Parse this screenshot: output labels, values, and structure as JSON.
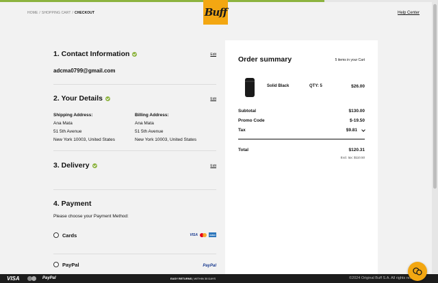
{
  "header": {
    "breadcrumb": [
      "HOME",
      "SHOPPING CART",
      "CHECKOUT"
    ],
    "logo_text": "Buff",
    "help_label": "Help Center",
    "progress_fraction": 0.74
  },
  "sections": {
    "contact": {
      "title": "1. Contact Information",
      "edit": "Edit",
      "email": "adcma0799@gmail.com"
    },
    "details": {
      "title": "2. Your Details",
      "edit": "Edit",
      "shipping": {
        "label": "Shipping Address:",
        "name": "Ana Mata",
        "street": "51 5th Avenue",
        "city": "New York 10003, United States"
      },
      "billing": {
        "label": "Billing Address:",
        "name": "Ana Mata",
        "street": "51 5th Avenue",
        "city": "New York 10003, United States"
      }
    },
    "delivery": {
      "title": "3. Delivery",
      "edit": "Edit"
    },
    "payment": {
      "title": "4. Payment",
      "description": "Please choose your Payment Method:",
      "options": [
        {
          "label": "Cards",
          "icons": [
            "VISA",
            "mastercard-icon",
            "AMEX"
          ]
        },
        {
          "label": "PayPal",
          "icons": [
            "PayPal"
          ]
        }
      ]
    }
  },
  "summary": {
    "title": "Order summary",
    "count": "5 items in your Cart",
    "item": {
      "name": "Solid Black",
      "qty": "QTY: 5",
      "price": "$26.00"
    },
    "rows": [
      {
        "label": "Subtotal",
        "value": "$130.00"
      },
      {
        "label": "Promo Code",
        "value": "$-19.50"
      },
      {
        "label": "Tax",
        "value": "$9.81"
      }
    ],
    "total": {
      "label": "Total",
      "value": "$120.31"
    },
    "excl_tax": "Excl. tax: $110.50"
  },
  "footer": {
    "visa": "VISA",
    "paypal": "PayPal",
    "returns_bold": "EASY RETURNS",
    "returns_rest": "| WITHIN 30 DAYS",
    "copyright": "©2024 Original Buff S.A. All rights reserved"
  },
  "colors": {
    "accent_green": "#8cb33f",
    "brand_orange": "#f3a712"
  }
}
